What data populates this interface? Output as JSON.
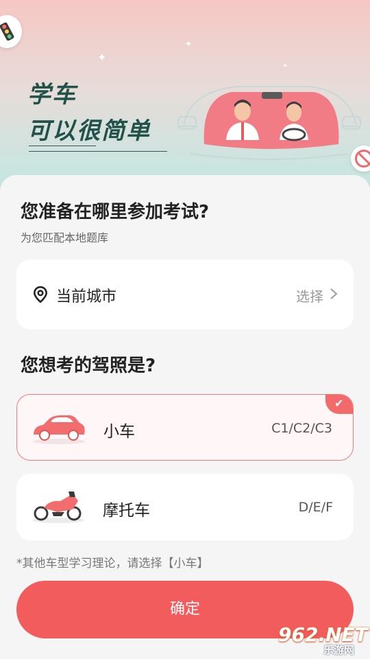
{
  "hero": {
    "slogan_line1": "学车",
    "slogan_line2": "可以很简单"
  },
  "location": {
    "question": "您准备在哪里参加考试?",
    "subtitle": "为您匹配本地题库",
    "city_label": "当前城市",
    "choose_label": "选择"
  },
  "license": {
    "question": "您想考的驾照是?",
    "options": [
      {
        "label": "小车",
        "codes": "C1/C2/C3",
        "selected": true,
        "icon": "car-icon"
      },
      {
        "label": "摩托车",
        "codes": "D/E/F",
        "selected": false,
        "icon": "motorcycle-icon"
      }
    ],
    "note": "*其他车型学习理论，请选择【小车】"
  },
  "confirm_label": "确定",
  "watermark": {
    "big": "962.NET",
    "small": "乐游网"
  },
  "colors": {
    "accent": "#f25c5c",
    "selected_border": "#f07b7b",
    "slogan": "#21524a",
    "page_bg": "#f5f5f5"
  }
}
